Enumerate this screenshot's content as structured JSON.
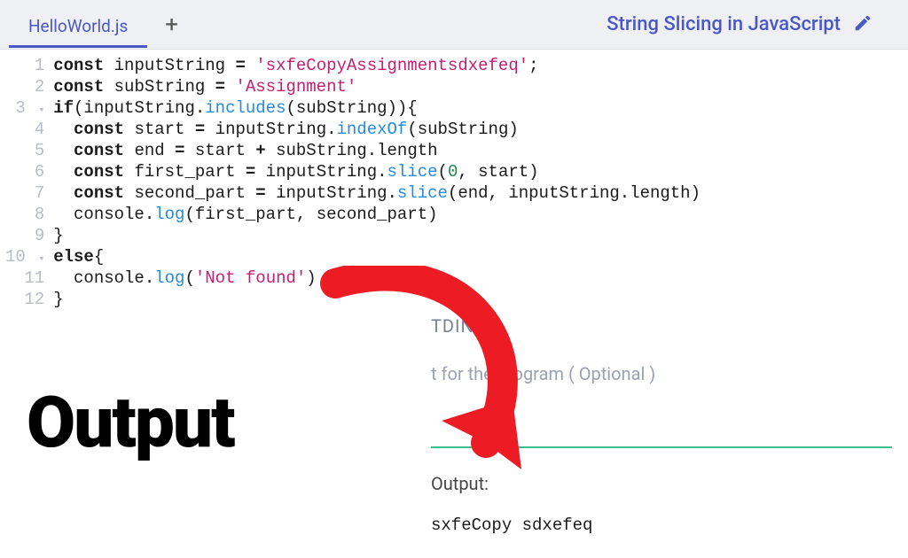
{
  "header": {
    "tab_name": "HelloWorld.js",
    "title": "String Slicing in JavaScript"
  },
  "code": {
    "lines": [
      {
        "n": 1,
        "tokens": [
          [
            "kw",
            "const"
          ],
          [
            "id",
            " inputString "
          ],
          [
            "kw",
            "="
          ],
          [
            "id",
            " "
          ],
          [
            "str",
            "'sxfeCopyAssignmentsdxefeq'"
          ],
          [
            "id",
            ";"
          ]
        ]
      },
      {
        "n": 2,
        "tokens": [
          [
            "kw",
            "const"
          ],
          [
            "id",
            " subString "
          ],
          [
            "kw",
            "="
          ],
          [
            "id",
            " "
          ],
          [
            "str",
            "'Assignment'"
          ]
        ]
      },
      {
        "n": 3,
        "fold": true,
        "tokens": [
          [
            "kw",
            "if"
          ],
          [
            "id",
            "(inputString."
          ],
          [
            "fn",
            "includes"
          ],
          [
            "id",
            "(subString)){"
          ]
        ]
      },
      {
        "n": 4,
        "tokens": [
          [
            "id",
            "  "
          ],
          [
            "kw",
            "const"
          ],
          [
            "id",
            " start "
          ],
          [
            "kw",
            "="
          ],
          [
            "id",
            " inputString."
          ],
          [
            "fn",
            "indexOf"
          ],
          [
            "id",
            "(subString)"
          ]
        ]
      },
      {
        "n": 5,
        "tokens": [
          [
            "id",
            "  "
          ],
          [
            "kw",
            "const"
          ],
          [
            "id",
            " end "
          ],
          [
            "kw",
            "="
          ],
          [
            "id",
            " start "
          ],
          [
            "kw",
            "+"
          ],
          [
            "id",
            " subString.length"
          ]
        ]
      },
      {
        "n": 6,
        "tokens": [
          [
            "id",
            "  "
          ],
          [
            "kw",
            "const"
          ],
          [
            "id",
            " first_part "
          ],
          [
            "kw",
            "="
          ],
          [
            "id",
            " inputString."
          ],
          [
            "fn",
            "slice"
          ],
          [
            "id",
            "("
          ],
          [
            "num",
            "0"
          ],
          [
            "id",
            ", start)"
          ]
        ]
      },
      {
        "n": 7,
        "tokens": [
          [
            "id",
            "  "
          ],
          [
            "kw",
            "const"
          ],
          [
            "id",
            " second_part "
          ],
          [
            "kw",
            "="
          ],
          [
            "id",
            " inputString."
          ],
          [
            "fn",
            "slice"
          ],
          [
            "id",
            "(end, inputString.length)"
          ]
        ]
      },
      {
        "n": 8,
        "tokens": [
          [
            "id",
            "  console."
          ],
          [
            "fn",
            "log"
          ],
          [
            "id",
            "(first_part, second_part)"
          ]
        ]
      },
      {
        "n": 9,
        "tokens": [
          [
            "id",
            "}"
          ]
        ]
      },
      {
        "n": 10,
        "fold": true,
        "tokens": [
          [
            "kw",
            "else"
          ],
          [
            "id",
            "{"
          ]
        ]
      },
      {
        "n": 11,
        "tokens": [
          [
            "id",
            "  console."
          ],
          [
            "fn",
            "log"
          ],
          [
            "id",
            "("
          ],
          [
            "str",
            "'Not found'"
          ],
          [
            "id",
            ")"
          ]
        ]
      },
      {
        "n": 12,
        "tokens": [
          [
            "id",
            "}"
          ]
        ]
      }
    ]
  },
  "io": {
    "stdin_label": "TDIN",
    "stdin_placeholder": "t for the program ( Optional )",
    "output_label": "Output:",
    "output_value": "sxfeCopy sdxefeq"
  },
  "annotation": {
    "big_label": "Output"
  },
  "colors": {
    "accent": "#4a57c7",
    "arrow": "#ed1c24",
    "divider": "#3bbf8c"
  }
}
